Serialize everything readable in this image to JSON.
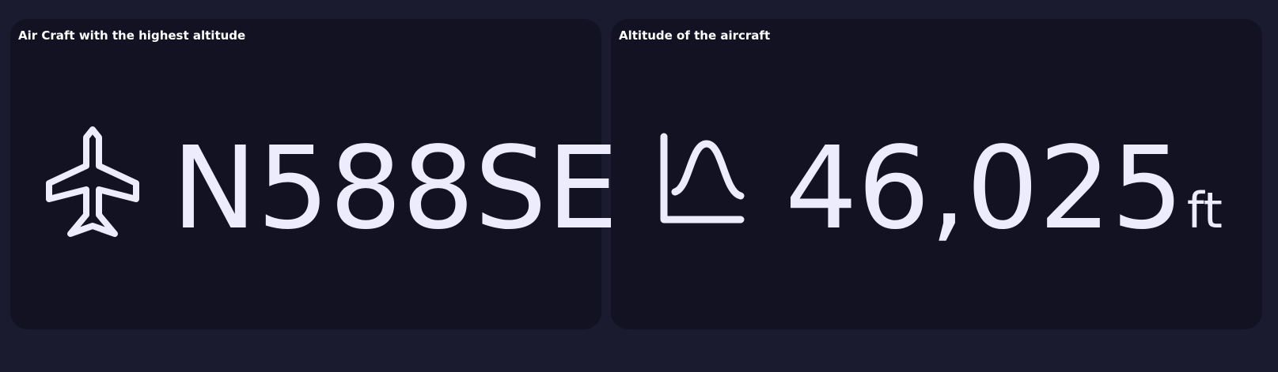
{
  "panels": [
    {
      "title": "Air Craft with the highest altitude",
      "icon": "airplane-icon",
      "value": "N588SE"
    },
    {
      "title": "Altitude of the aircraft",
      "icon": "bell-curve-chart-icon",
      "value": "46,025",
      "unit": "ft"
    }
  ],
  "colors": {
    "page_background": "#1a1b2e",
    "card_background": "#121223",
    "value_text": "#ececfd",
    "title_text": "#ffffff"
  }
}
